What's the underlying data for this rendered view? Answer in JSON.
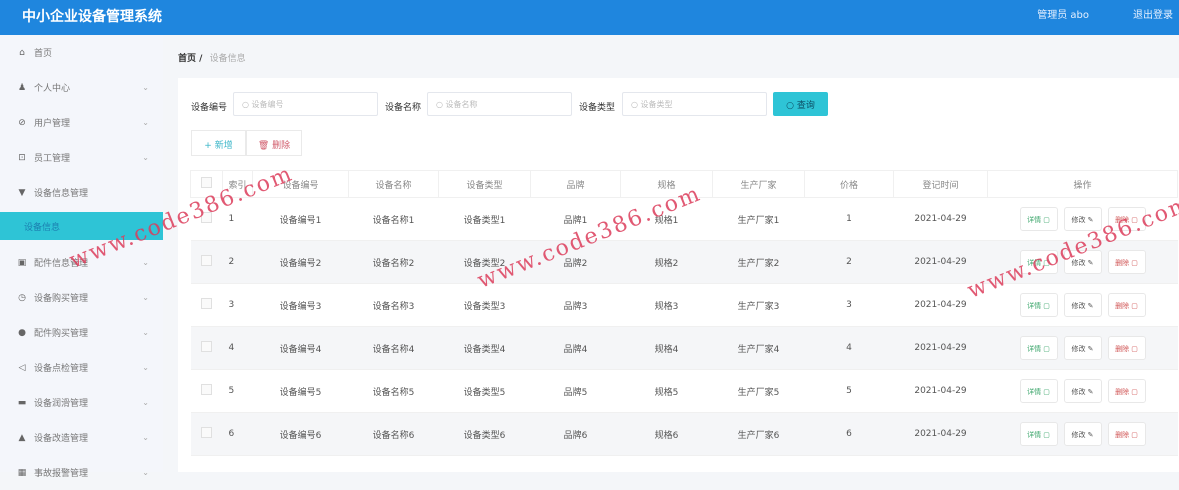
{
  "header": {
    "title": "中小企业设备管理系统",
    "user": "管理员 abo",
    "logout": "退出登录"
  },
  "sidebar": {
    "items": [
      {
        "label": "首页",
        "icon": "⌂",
        "chev": ""
      },
      {
        "label": "个人中心",
        "icon": "♟",
        "chev": "⌄"
      },
      {
        "label": "用户管理",
        "icon": "⊘",
        "chev": "⌄"
      },
      {
        "label": "员工管理",
        "icon": "⊡",
        "chev": "⌄"
      },
      {
        "label": "设备信息管理",
        "icon": "▼",
        "chev": ""
      },
      {
        "label": "设备信息",
        "icon": "",
        "chev": ""
      },
      {
        "label": "配件信息管理",
        "icon": "▣",
        "chev": "⌄"
      },
      {
        "label": "设备购买管理",
        "icon": "◷",
        "chev": "⌄"
      },
      {
        "label": "配件购买管理",
        "icon": "●",
        "chev": "⌄"
      },
      {
        "label": "设备点检管理",
        "icon": "◁",
        "chev": "⌄"
      },
      {
        "label": "设备润滑管理",
        "icon": "▬",
        "chev": "⌄"
      },
      {
        "label": "设备改造管理",
        "icon": "▲",
        "chev": "⌄"
      },
      {
        "label": "事故报警管理",
        "icon": "▦",
        "chev": "⌄"
      }
    ]
  },
  "breadcrumb": {
    "home": "首页",
    "sep": "/",
    "current": "设备信息"
  },
  "search": {
    "f1_label": "设备编号",
    "f1_ph": "设备编号",
    "f2_label": "设备名称",
    "f2_ph": "设备名称",
    "f3_label": "设备类型",
    "f3_ph": "设备类型",
    "query": "查询"
  },
  "actions": {
    "add": "新增",
    "delete": "删除"
  },
  "table": {
    "headers": [
      "索引",
      "设备编号",
      "设备名称",
      "设备类型",
      "品牌",
      "规格",
      "生产厂家",
      "价格",
      "登记时间",
      "操作"
    ],
    "rows": [
      [
        "1",
        "设备编号1",
        "设备名称1",
        "设备类型1",
        "品牌1",
        "规格1",
        "生产厂家1",
        "1",
        "2021-04-29"
      ],
      [
        "2",
        "设备编号2",
        "设备名称2",
        "设备类型2",
        "品牌2",
        "规格2",
        "生产厂家2",
        "2",
        "2021-04-29"
      ],
      [
        "3",
        "设备编号3",
        "设备名称3",
        "设备类型3",
        "品牌3",
        "规格3",
        "生产厂家3",
        "3",
        "2021-04-29"
      ],
      [
        "4",
        "设备编号4",
        "设备名称4",
        "设备类型4",
        "品牌4",
        "规格4",
        "生产厂家4",
        "4",
        "2021-04-29"
      ],
      [
        "5",
        "设备编号5",
        "设备名称5",
        "设备类型5",
        "品牌5",
        "规格5",
        "生产厂家5",
        "5",
        "2021-04-29"
      ],
      [
        "6",
        "设备编号6",
        "设备名称6",
        "设备类型6",
        "品牌6",
        "规格6",
        "生产厂家6",
        "6",
        "2021-04-29"
      ]
    ],
    "ops": {
      "detail": "详情",
      "edit": "修改",
      "remove": "删除"
    }
  },
  "watermark": "www.code386.com"
}
